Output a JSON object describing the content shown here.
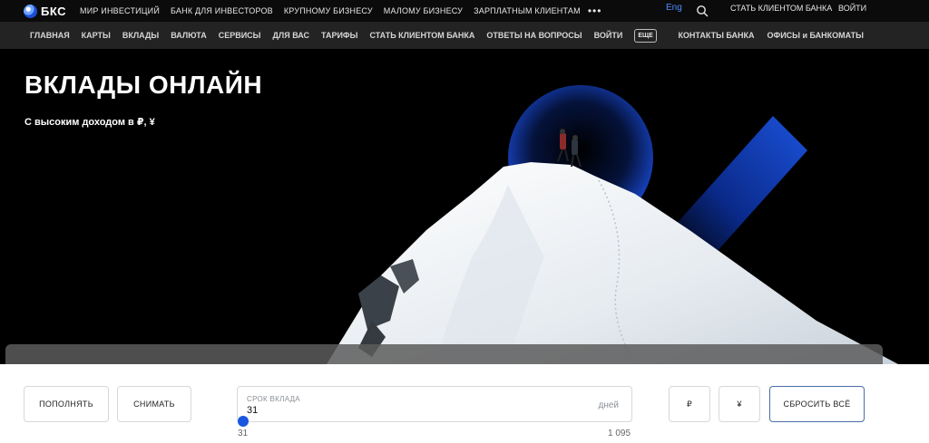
{
  "brand": {
    "name": "БКС",
    "colors": {
      "accent": "#1a56e0",
      "link": "#4d8cff"
    }
  },
  "top_nav": {
    "items": [
      "МИР ИНВЕСТИЦИЙ",
      "БАНК ДЛЯ ИНВЕСТОРОВ",
      "КРУПНОМУ БИЗНЕСУ",
      "МАЛОМУ БИЗНЕСУ",
      "ЗАРПЛАТНЫМ КЛИЕНТАМ"
    ],
    "more": "•••",
    "lang": "Eng",
    "search_icon": "search-icon",
    "become_client": "СТАТЬ КЛИЕНТОМ БАНКА",
    "login": "ВОЙТИ"
  },
  "main_nav": {
    "items": [
      "ГЛАВНАЯ",
      "КАРТЫ",
      "ВКЛАДЫ",
      "ВАЛЮТА",
      "СЕРВИСЫ",
      "ДЛЯ ВАС",
      "ТАРИФЫ",
      "СТАТЬ КЛИЕНТОМ БАНКА",
      "ОТВЕТЫ НА ВОПРОСЫ",
      "ВОЙТИ"
    ],
    "more_badge": "ЕЩЕ",
    "right_items": [
      "КОНТАКТЫ БАНКА",
      "ОФИСЫ и БАНКОМАТЫ"
    ]
  },
  "hero": {
    "title": "ВКЛАДЫ ОНЛАЙН",
    "subtitle": "С высоким доходом в ₽, ¥"
  },
  "filters": {
    "topup_button": "ПОПОЛНЯТЬ",
    "withdraw_button": "СНИМАТЬ",
    "term_label": "СРОК ВКЛАДА",
    "term_value": "31",
    "term_unit": "дней",
    "range_min": "31",
    "range_max": "1 095",
    "currency_rub": "₽",
    "currency_yen": "¥",
    "reset_button": "СБРОСИТЬ ВСЁ"
  }
}
